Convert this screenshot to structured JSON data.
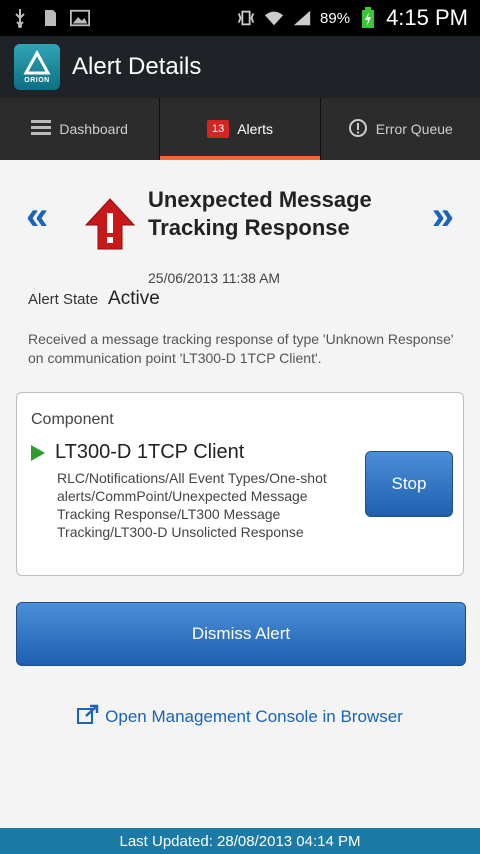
{
  "status_bar": {
    "battery_percent": "89%",
    "time": "4:15 PM",
    "icons": [
      "usb-icon",
      "sd-card-icon",
      "image-icon",
      "vibrate-icon",
      "wifi-icon",
      "signal-icon",
      "battery-charging-icon"
    ]
  },
  "action_bar": {
    "title": "Alert Details",
    "logo_text": "ORION"
  },
  "tabs": [
    {
      "label": "Dashboard",
      "icon": "list-icon",
      "active": false
    },
    {
      "label": "Alerts",
      "badge": "13",
      "active": true
    },
    {
      "label": "Error Queue",
      "icon": "exclamation-circle-icon",
      "active": false
    }
  ],
  "alert": {
    "title": "Unexpected Message Tracking Response",
    "date": "25/06/2013 11:38 AM",
    "state_label": "Alert State",
    "state_value": "Active",
    "message": "Received a message tracking response of type 'Unknown Response' on communication point 'LT300-D 1TCP Client'.",
    "nav_prev": "«",
    "nav_next": "»"
  },
  "component": {
    "header": "Component",
    "name": "LT300-D 1TCP Client",
    "path": "RLC/Notifications/All Event Types/One-shot alerts/CommPoint/Unexpected Message Tracking Response/LT300 Message Tracking/LT300-D Unsolicted Response",
    "stop_label": "Stop"
  },
  "actions": {
    "dismiss_label": "Dismiss Alert",
    "console_link": "Open Management Console in Browser"
  },
  "footer": {
    "text": "Last Updated: 28/08/2013 04:14 PM"
  },
  "colors": {
    "accent_blue": "#1a63b8",
    "tab_indicator": "#f06a2a",
    "warning_red": "#c81818",
    "footer_bg": "#1c7aa6"
  }
}
